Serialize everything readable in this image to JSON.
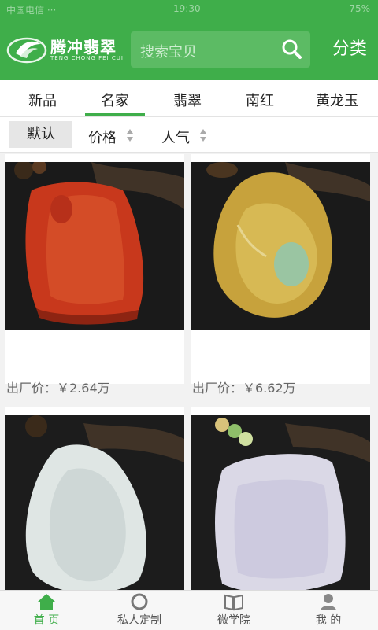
{
  "statusbar": {
    "left": "中国电信 ···",
    "time": "19:30",
    "right": "75%"
  },
  "header": {
    "brand_name": "腾冲翡翠",
    "brand_sub": "TENG CHONG FEI CUI",
    "search_placeholder": "搜索宝贝",
    "category_label": "分类",
    "accent_color": "#3fae4a"
  },
  "tabs": [
    {
      "label": "新品"
    },
    {
      "label": "名家",
      "active": true
    },
    {
      "label": "翡翠"
    },
    {
      "label": "南红"
    },
    {
      "label": "黄龙玉"
    }
  ],
  "sort": {
    "default_label": "默认",
    "price_label": "价格",
    "popularity_label": "人气"
  },
  "products": [
    {
      "price": "出厂价：￥2.64万",
      "image": "red-agate-pendant"
    },
    {
      "price": "出厂价：￥6.62万",
      "image": "yellow-jade-pendant"
    },
    {
      "price": "",
      "image": "white-jade-guanyin-pendant"
    },
    {
      "price": "",
      "image": "lavender-jade-plaque"
    }
  ],
  "tabbar": [
    {
      "label": "首 页",
      "icon": "home-icon",
      "active": true
    },
    {
      "label": "私人定制",
      "icon": "circle-icon"
    },
    {
      "label": "微学院",
      "icon": "book-icon"
    },
    {
      "label": "我 的",
      "icon": "user-icon"
    }
  ]
}
